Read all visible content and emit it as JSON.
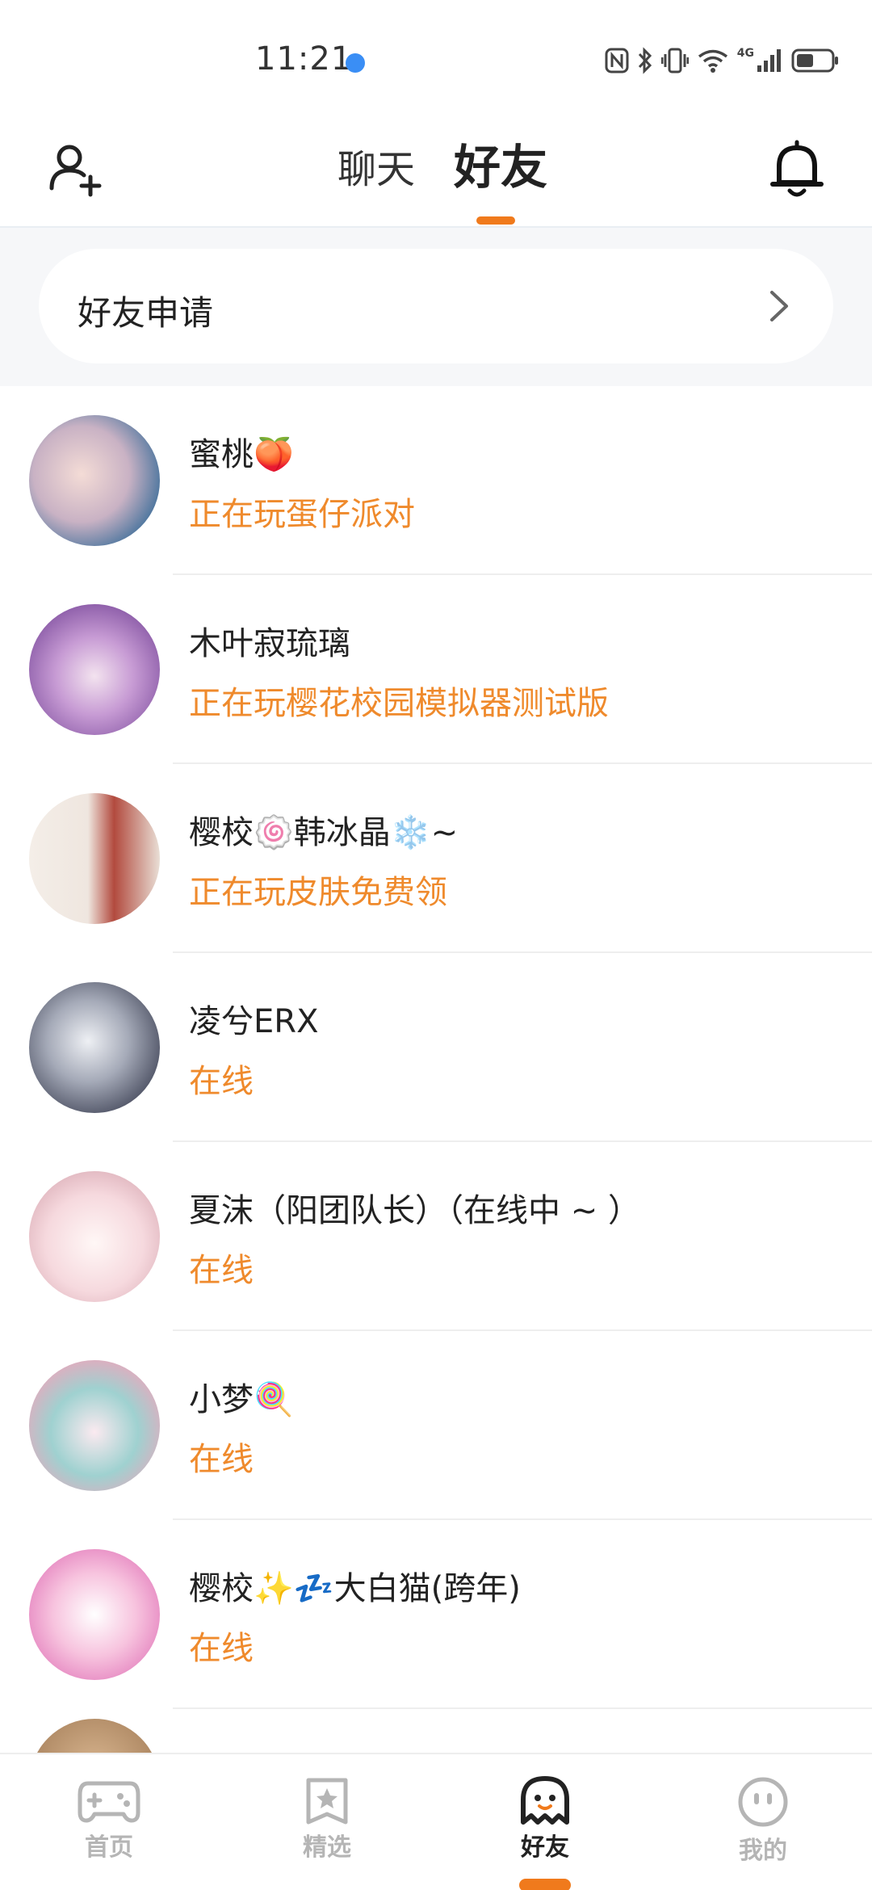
{
  "status_bar": {
    "time": "11:21",
    "network": "4G",
    "icons": [
      "nfc-icon",
      "bluetooth-icon",
      "vibrate-icon",
      "wifi-icon",
      "signal-icon",
      "battery-icon"
    ]
  },
  "header": {
    "tabs": [
      {
        "label": "聊天",
        "active": false
      },
      {
        "label": "好友",
        "active": true
      }
    ],
    "left_icon": "add-friend-icon",
    "right_icon": "bell-icon"
  },
  "friend_request": {
    "label": "好友申请"
  },
  "friends": [
    {
      "name": "蜜桃🍑",
      "status": "正在玩蛋仔派对",
      "avatar_color": "#5a7ea8"
    },
    {
      "name": "木叶寂琉璃",
      "status": "正在玩樱花校园模拟器测试版",
      "avatar_color": "#9c6fb8"
    },
    {
      "name": "樱校🍥韩冰晶❄️~",
      "status": "正在玩皮肤免费领",
      "avatar_color": "#d8b9a8"
    },
    {
      "name": "凌兮ERX",
      "status": "在线",
      "avatar_color": "#5f6a80"
    },
    {
      "name": "夏沫（阳团队长）（在线中 ~ ）",
      "status": "在线",
      "avatar_color": "#f0c9cf"
    },
    {
      "name": "小梦🍭",
      "status": "在线",
      "avatar_color": "#8fc8c8"
    },
    {
      "name": "樱校✨💤大白猫(跨年)",
      "status": "在线",
      "avatar_color": "#f3a7d0"
    }
  ],
  "bottom_nav": [
    {
      "label": "首页",
      "icon": "gamepad-icon",
      "active": false
    },
    {
      "label": "精选",
      "icon": "star-bookmark-icon",
      "active": false
    },
    {
      "label": "好友",
      "icon": "ghost-icon",
      "active": true
    },
    {
      "label": "我的",
      "icon": "smiley-icon",
      "active": false
    }
  ],
  "colors": {
    "accent": "#f07a1c",
    "status_text": "#ef8a2c"
  }
}
